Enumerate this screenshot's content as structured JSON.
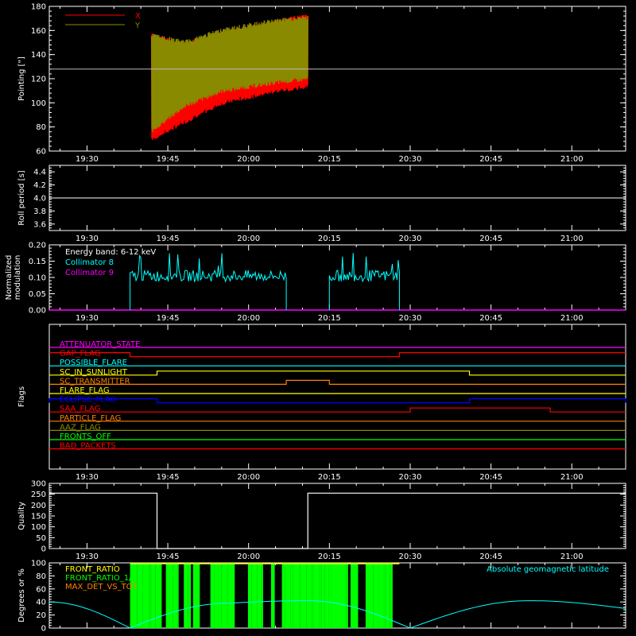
{
  "time_ticks": [
    "19:30",
    "19:45",
    "20:00",
    "20:15",
    "20:30",
    "20:45",
    "21:00"
  ],
  "chart_data": [
    {
      "type": "line",
      "id": "pointing",
      "ylabel": "Pointing [\"]",
      "ylim": [
        60,
        180
      ],
      "yticks": [
        60,
        80,
        100,
        120,
        140,
        160,
        180
      ],
      "legend": [
        {
          "name": "X",
          "color": "#ff0000"
        },
        {
          "name": "Y",
          "color": "#8a8a00"
        }
      ],
      "reference_line": 128,
      "series": [
        {
          "name": "X",
          "color": "#ff0000",
          "x_start": "19:42",
          "x_end": "20:11",
          "envelope": [
            {
              "t": "19:42",
              "min": 68,
              "max": 158
            },
            {
              "t": "19:48",
              "min": 82,
              "max": 150
            },
            {
              "t": "19:55",
              "min": 98,
              "max": 160
            },
            {
              "t": "20:05",
              "min": 108,
              "max": 168
            },
            {
              "t": "20:11",
              "min": 112,
              "max": 175
            }
          ]
        },
        {
          "name": "Y",
          "color": "#8a8a00",
          "x_start": "19:42",
          "x_end": "20:11",
          "envelope": [
            {
              "t": "19:42",
              "min": 75,
              "max": 158
            },
            {
              "t": "19:48",
              "min": 95,
              "max": 152
            },
            {
              "t": "19:55",
              "min": 108,
              "max": 162
            },
            {
              "t": "20:05",
              "min": 115,
              "max": 170
            },
            {
              "t": "20:11",
              "min": 118,
              "max": 172
            }
          ]
        }
      ]
    },
    {
      "type": "line",
      "id": "roll",
      "ylabel": "Roll period [s]",
      "ylim": [
        3.5,
        4.5
      ],
      "yticks": [
        3.6,
        3.8,
        4.0,
        4.2,
        4.4
      ],
      "series": [
        {
          "name": "Roll period",
          "color": "#ffffff",
          "y": 4.0,
          "x_start": "19:23",
          "x_end": "21:10"
        }
      ]
    },
    {
      "type": "line",
      "id": "modulation",
      "ylabel": "Normalized modulation",
      "ylim": [
        0,
        0.2
      ],
      "yticks": [
        0.0,
        0.05,
        0.1,
        0.15,
        0.2
      ],
      "annotation": "Energy band: 6-12 keV",
      "legend": [
        {
          "name": "Collimator 8",
          "color": "#00ffff"
        },
        {
          "name": "Collimator 9",
          "color": "#ff00ff"
        }
      ],
      "series": [
        {
          "name": "Collimator 8",
          "color": "#00ffff",
          "segments": [
            {
              "start": "19:38",
              "end": "20:07",
              "mean": 0.105
            },
            {
              "start": "20:15",
              "end": "20:28",
              "mean": 0.105
            }
          ]
        },
        {
          "name": "Collimator 9",
          "color": "#ff00ff",
          "y": 0,
          "x_start": "19:23",
          "x_end": "21:10"
        }
      ]
    },
    {
      "type": "line",
      "id": "flags",
      "ylabel": "Flags",
      "flags": [
        {
          "name": "ATTENUATOR_STATE",
          "color": "#ff00ff",
          "high": []
        },
        {
          "name": "GAP_FLAG",
          "color": "#ff0000",
          "high": [
            [
              "19:38",
              "20:28"
            ]
          ],
          "invert": true
        },
        {
          "name": "POSSIBLE_FLARE",
          "color": "#00ffff",
          "high": []
        },
        {
          "name": "SC_IN_SUNLIGHT",
          "color": "#ffff00",
          "high": [
            [
              "19:43",
              "20:41"
            ]
          ]
        },
        {
          "name": "SC_TRANSMITTER",
          "color": "#ff7f00",
          "high": [
            [
              "20:07",
              "20:15"
            ]
          ]
        },
        {
          "name": "FLARE_FLAG",
          "color": "#ffff00",
          "high": []
        },
        {
          "name": "ECLIPSE_FLAG",
          "color": "#0000ff",
          "high": [
            [
              "19:23",
              "19:43"
            ],
            [
              "20:41",
              "21:10"
            ]
          ]
        },
        {
          "name": "SAA_FLAG",
          "color": "#ff0000",
          "high": [
            [
              "20:30",
              "20:56"
            ]
          ]
        },
        {
          "name": "PARTICLE_FLAG",
          "color": "#ff7f00",
          "high": []
        },
        {
          "name": "AAZ_FLAG",
          "color": "#8a8a00",
          "high": []
        },
        {
          "name": "FRONTS_OFF",
          "color": "#00ff00",
          "high": []
        },
        {
          "name": "BAD_PACKETS",
          "color": "#ff0000",
          "high": []
        }
      ]
    },
    {
      "type": "line",
      "id": "quality",
      "ylabel": "Quality",
      "ylim": [
        0,
        300
      ],
      "yticks": [
        0,
        50,
        100,
        150,
        200,
        250,
        300
      ],
      "series": [
        {
          "name": "Quality",
          "color": "#ffffff",
          "points": [
            [
              "19:23",
              255
            ],
            [
              "19:43",
              255
            ],
            [
              "19:43",
              0
            ],
            [
              "20:11",
              0
            ],
            [
              "20:11",
              255
            ],
            [
              "21:10",
              255
            ]
          ]
        }
      ]
    },
    {
      "type": "line",
      "id": "geomag",
      "ylabel": "Degrees or %",
      "ylim": [
        0,
        100
      ],
      "yticks": [
        0,
        20,
        40,
        60,
        80,
        100
      ],
      "legend": [
        {
          "name": "FRONT_RATIO",
          "color": "#ffff00"
        },
        {
          "name": "FRONT_RATIO_1/2",
          "color": "#00ff00"
        },
        {
          "name": "MAX_DET_VS_TOT",
          "color": "#ff7f00"
        }
      ],
      "annotation": "Absolute geomagnetic latitude",
      "annotation_color": "#00ffff",
      "fill": {
        "name": "FRONT_RATIO_1/2",
        "color": "#00ff00",
        "start": "19:38",
        "end": "20:28"
      },
      "series": [
        {
          "name": "Absolute geomagnetic latitude",
          "color": "#00ffff",
          "points": [
            [
              "19:23",
              40
            ],
            [
              "19:38",
              0
            ],
            [
              "19:56",
              38
            ],
            [
              "20:11",
              42
            ],
            [
              "20:30",
              0
            ],
            [
              "20:52",
              42
            ],
            [
              "21:10",
              30
            ]
          ]
        }
      ]
    }
  ]
}
